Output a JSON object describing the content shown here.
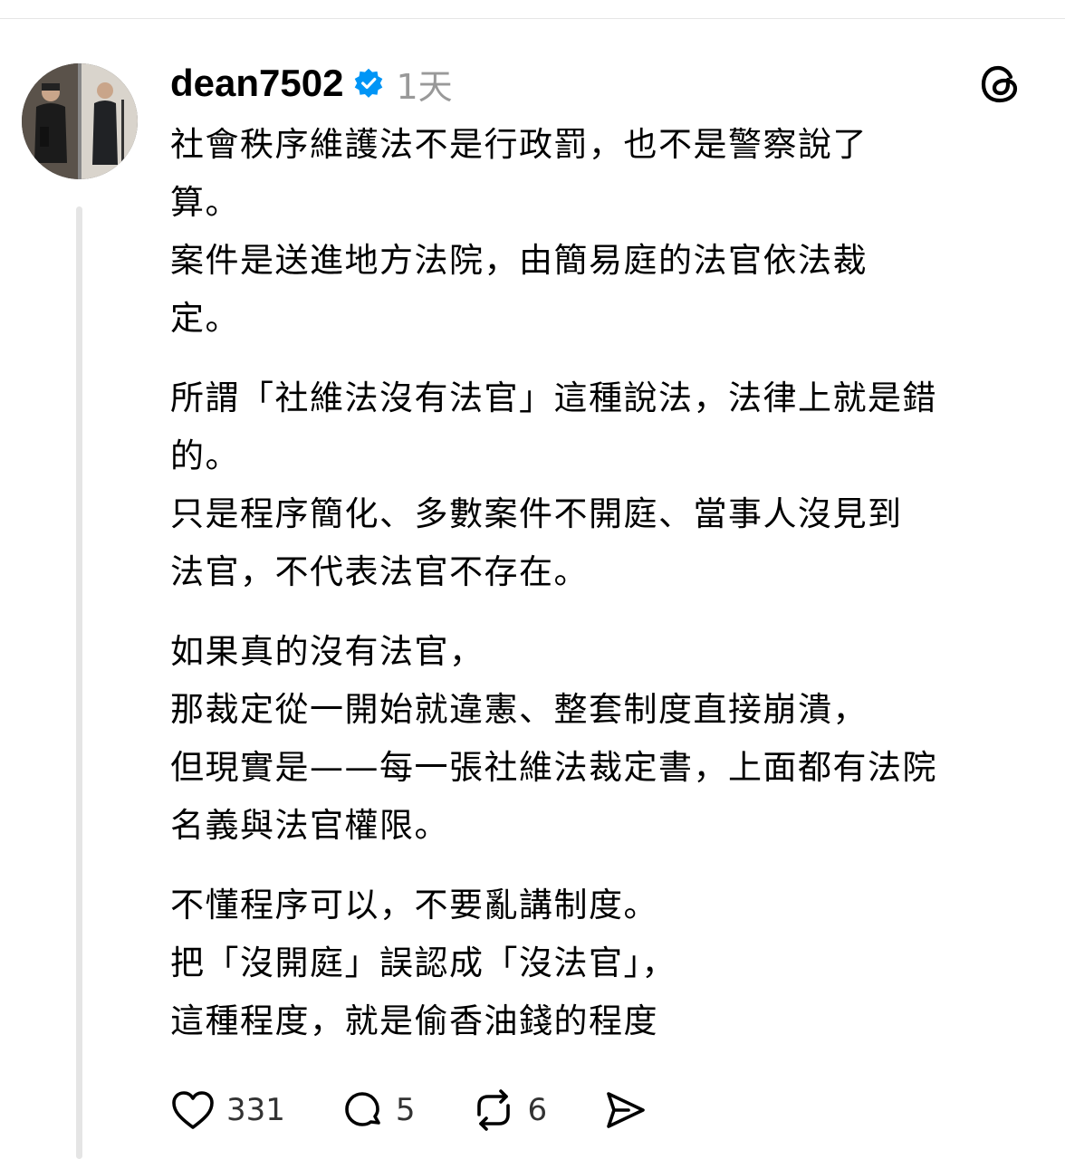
{
  "post": {
    "username": "dean7502",
    "time": "1天",
    "paragraphs": [
      [
        "社會秩序維護法不是行政罰，也不是警察說了",
        "算。",
        "案件是送進地方法院，由簡易庭的法官依法裁",
        "定。"
      ],
      [
        "所謂「社維法沒有法官」這種說法，法律上就是錯",
        "的。",
        "只是程序簡化、多數案件不開庭、當事人沒見到",
        "法官，不代表法官不存在。"
      ],
      [
        "如果真的沒有法官，",
        "那裁定從一開始就違憲、整套制度直接崩潰，",
        "但現實是——每一張社維法裁定書，上面都有法院",
        "名義與法官權限。"
      ],
      [
        "不懂程序可以，不要亂講制度。",
        "把「沒開庭」誤認成「沒法官」，",
        "這種程度，就是偷香油錢的程度"
      ]
    ]
  },
  "actions": {
    "like_count": "331",
    "reply_count": "5",
    "repost_count": "6"
  },
  "icons": {
    "verified": "verified-badge-icon",
    "app": "threads-logo-icon",
    "like": "heart-icon",
    "reply": "comment-icon",
    "repost": "repost-icon",
    "share": "send-icon"
  },
  "colors": {
    "verified": "#0095f6",
    "muted": "#999999",
    "thread_line": "#e5e5e5"
  }
}
